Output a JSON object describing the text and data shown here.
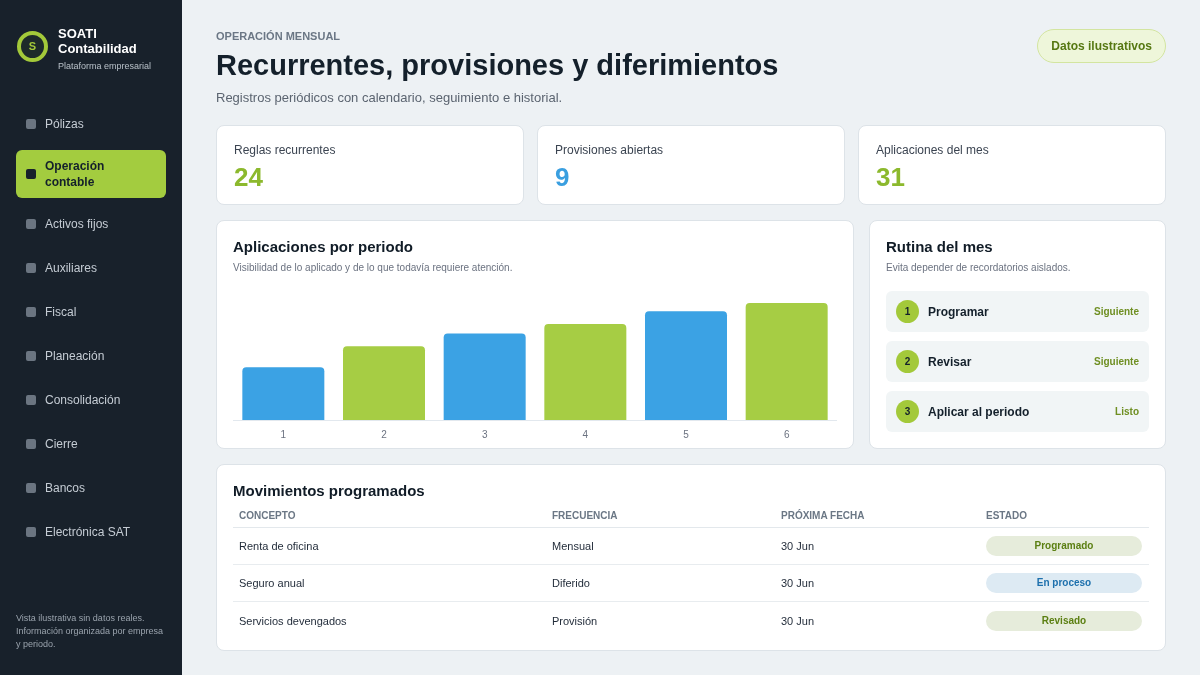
{
  "sidebar": {
    "logo": {
      "letter": "S"
    },
    "brand": "SOATI Contabilidad",
    "tagline": "Plataforma empresarial",
    "nav": [
      {
        "label": "Pólizas",
        "selected": false
      },
      {
        "label": "Operación contable",
        "selected": true
      },
      {
        "label": "Activos fijos",
        "selected": false
      },
      {
        "label": "Auxiliares",
        "selected": false
      },
      {
        "label": "Fiscal",
        "selected": false
      },
      {
        "label": "Planeación",
        "selected": false
      },
      {
        "label": "Consolidación",
        "selected": false
      },
      {
        "label": "Cierre",
        "selected": false
      },
      {
        "label": "Bancos",
        "selected": false
      },
      {
        "label": "Electrónica SAT",
        "selected": false
      }
    ],
    "footer_note": "Vista ilustrativa sin datos reales. Información organizada por empresa y periodo."
  },
  "header": {
    "eyebrow": "OPERACIÓN MENSUAL",
    "title": "Recurrentes, provisiones y diferimientos",
    "subtitle": "Registros periódicos con calendario, seguimiento e historial.",
    "badge": "Datos ilustrativos"
  },
  "stats": [
    {
      "label": "Reglas recurrentes",
      "value": "24",
      "color": "#8cb92d"
    },
    {
      "label": "Provisiones abiertas",
      "value": "9",
      "color": "#3a9fe0"
    },
    {
      "label": "Aplicaciones del mes",
      "value": "31",
      "color": "#8cb92d"
    }
  ],
  "chart_panel": {
    "title": "Aplicaciones por periodo",
    "subtitle": "Visibilidad de lo aplicado y de lo que todavía requiere atención.",
    "period_labels": [
      "1",
      "2",
      "3",
      "4",
      "5",
      "6"
    ]
  },
  "routine": {
    "title": "Rutina del mes",
    "subtitle": "Evita depender de recordatorios aislados.",
    "steps": [
      {
        "number": "1",
        "label": "Programar",
        "status": "Siguiente"
      },
      {
        "number": "2",
        "label": "Revisar",
        "status": "Siguiente"
      },
      {
        "number": "3",
        "label": "Aplicar al periodo",
        "status": "Listo"
      }
    ]
  },
  "table": {
    "title": "Movimientos programados",
    "columns": [
      "CONCEPTO",
      "FRECUENCIA",
      "PRÓXIMA FECHA",
      "ESTADO"
    ],
    "rows": [
      {
        "concept": "Renta de oficina",
        "frequency": "Mensual",
        "next_date": "30 Jun",
        "status": {
          "label": "Programado",
          "color": "#5b7f12"
        }
      },
      {
        "concept": "Seguro anual",
        "frequency": "Diferido",
        "next_date": "30 Jun",
        "status": {
          "label": "En proceso",
          "color": "#1d70ad"
        }
      },
      {
        "concept": "Servicios devengados",
        "frequency": "Provisión",
        "next_date": "30 Jun",
        "status": {
          "label": "Revisado",
          "color": "#5b7f12"
        }
      }
    ]
  }
}
